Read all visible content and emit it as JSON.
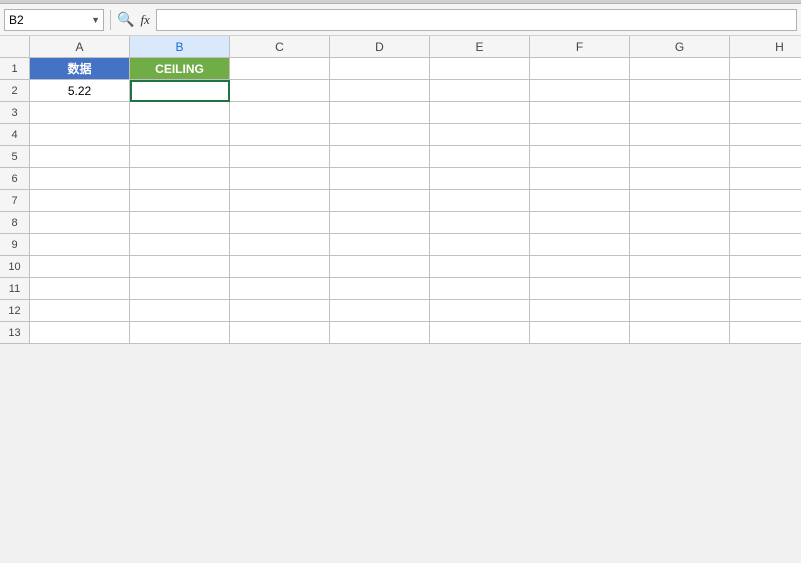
{
  "toolbar": {
    "name_box_value": "B2",
    "formula_bar_value": ""
  },
  "columns": [
    "A",
    "B",
    "C",
    "D",
    "E",
    "F",
    "G",
    "H"
  ],
  "header_row": {
    "row_num": "1",
    "cells": [
      {
        "col": "A",
        "value": "数据",
        "type": "header-blue"
      },
      {
        "col": "B",
        "value": "CEILING",
        "type": "header-green"
      },
      {
        "col": "C",
        "value": "",
        "type": "empty"
      },
      {
        "col": "D",
        "value": "",
        "type": "empty"
      },
      {
        "col": "E",
        "value": "",
        "type": "empty"
      },
      {
        "col": "F",
        "value": "",
        "type": "empty"
      },
      {
        "col": "G",
        "value": "",
        "type": "empty"
      },
      {
        "col": "H",
        "value": "",
        "type": "empty"
      }
    ]
  },
  "data_rows": [
    {
      "row_num": "2",
      "cells": [
        {
          "col": "A",
          "value": "5.22",
          "type": "number"
        },
        {
          "col": "B",
          "value": "",
          "type": "selected"
        },
        {
          "col": "C",
          "value": "",
          "type": "empty"
        },
        {
          "col": "D",
          "value": "",
          "type": "empty"
        },
        {
          "col": "E",
          "value": "",
          "type": "empty"
        },
        {
          "col": "F",
          "value": "",
          "type": "empty"
        },
        {
          "col": "G",
          "value": "",
          "type": "empty"
        },
        {
          "col": "H",
          "value": "",
          "type": "empty"
        }
      ]
    },
    {
      "row_num": "3"
    },
    {
      "row_num": "4"
    },
    {
      "row_num": "5"
    },
    {
      "row_num": "6"
    },
    {
      "row_num": "7"
    },
    {
      "row_num": "8"
    },
    {
      "row_num": "9"
    },
    {
      "row_num": "10"
    },
    {
      "row_num": "11"
    },
    {
      "row_num": "12"
    },
    {
      "row_num": "13"
    }
  ],
  "icons": {
    "zoom": "🔍",
    "dropdown_arrow": "▼"
  }
}
